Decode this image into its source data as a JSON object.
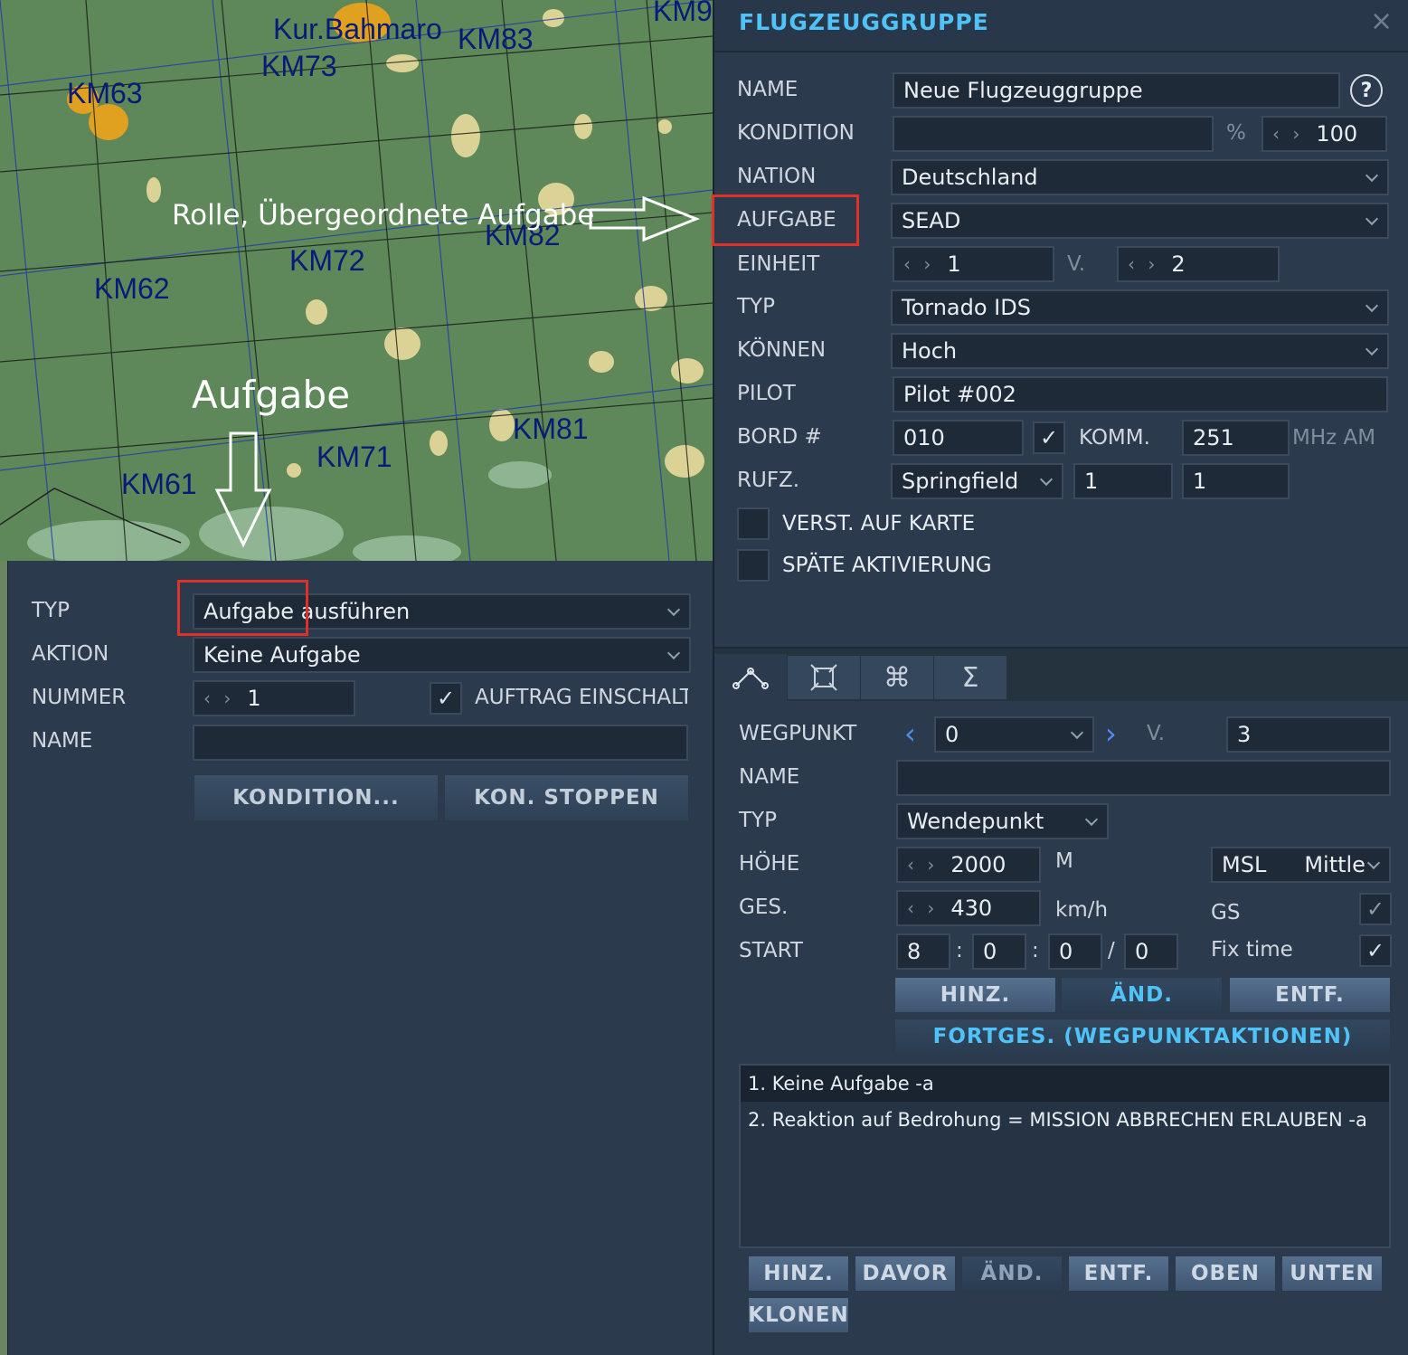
{
  "map": {
    "labels": [
      "KM63",
      "Kur.Bahmaro",
      "KM73",
      "KM83",
      "KM9",
      "KM82",
      "KM72",
      "KM62",
      "KM81",
      "KM71",
      "KM61"
    ],
    "annotation_role": "Rolle, Übergeordnete Aufgabe",
    "annotation_task": "Aufgabe"
  },
  "left_panel": {
    "typ_label": "TYP",
    "typ_value": "Aufgabe ausführen",
    "aktion_label": "AKTION",
    "aktion_value": "Keine Aufgabe",
    "nummer_label": "NUMMER",
    "nummer_value": "1",
    "auftrag_label": "AUFTRAG EINSCHALT",
    "name_label": "NAME",
    "name_value": "",
    "kondition_button": "KONDITION...",
    "stop_button": "KON. STOPPEN"
  },
  "group": {
    "title": "FLUGZEUGGRUPPE",
    "close": "×",
    "help": "?",
    "name_label": "NAME",
    "name_value": "Neue Flugzeuggruppe",
    "kondition_label": "KONDITION",
    "kondition_value": "",
    "percent": "%",
    "percent_value": "100",
    "nation_label": "NATION",
    "nation_value": "Deutschland",
    "aufgabe_label": "AUFGABE",
    "aufgabe_value": "SEAD",
    "einheit_label": "EINHEIT",
    "einheit_value": "1",
    "einheit_of": "V.",
    "einheit_total": "2",
    "typ_label": "TYP",
    "typ_value": "Tornado IDS",
    "koennen_label": "KÖNNEN",
    "koennen_value": "Hoch",
    "pilot_label": "PILOT",
    "pilot_value": "Pilot #002",
    "bord_label": "BORD #",
    "bord_value": "010",
    "komm_label": "KOMM.",
    "komm_value": "251",
    "komm_unit": "MHz AM",
    "rufz_label": "RUFZ.",
    "rufz_value": "Springfield",
    "rufz_num1": "1",
    "rufz_num2": "1",
    "verst_label": "VERST. AUF KARTE",
    "spaete_label": "SPÄTE AKTIVIERUNG"
  },
  "waypoint": {
    "wegpunkt_label": "WEGPUNKT",
    "wegpunkt_value": "0",
    "of_label": "V.",
    "total": "3",
    "name_label": "NAME",
    "name_value": "",
    "typ_label": "TYP",
    "typ_value": "Wendepunkt",
    "hoehe_label": "HÖHE",
    "hoehe_value": "2000",
    "hoehe_unit": "M",
    "msl": "MSL",
    "mittle": "Mittle",
    "ges_label": "GES.",
    "ges_value": "430",
    "ges_unit": "km/h",
    "gs_label": "GS",
    "start_label": "START",
    "start_h": "8",
    "start_m": "0",
    "start_s": "0",
    "start_d": "0",
    "fix_time_label": "Fix time",
    "btn_add": "HINZ.",
    "btn_edit": "ÄND.",
    "btn_del": "ENTF.",
    "btn_advanced": "FORTGES. (WEGPUNKTAKTIONEN)",
    "actions": [
      "1. Keine Aufgabe -a",
      "2. Reaktion auf Bedrohung = MISSION ABBRECHEN ERLAUBEN -a"
    ],
    "list_btn_add": "HINZ.",
    "list_btn_before": "DAVOR",
    "list_btn_edit": "ÄND.",
    "list_btn_del": "ENTF.",
    "list_btn_up": "OBEN",
    "list_btn_down": "UNTEN",
    "list_btn_clone": "KLONEN"
  },
  "colors": {
    "accent": "#4fc3f7",
    "panel": "#2b3a4d",
    "map_green": "#5f8a5a",
    "highlight": "#e0302a"
  }
}
